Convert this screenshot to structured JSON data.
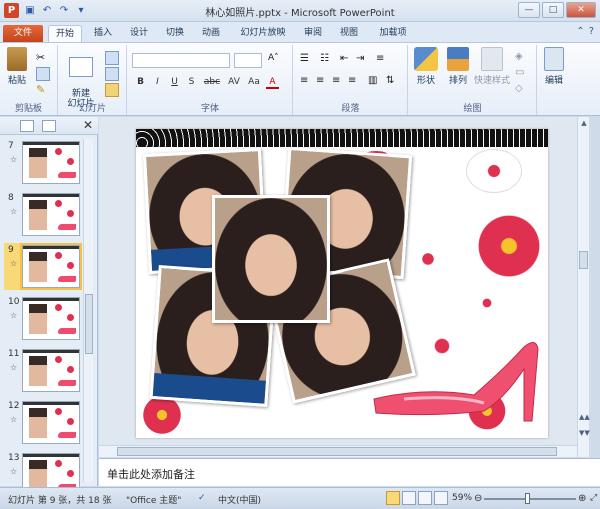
{
  "window": {
    "title": "林心如照片.pptx - Microsoft PowerPoint"
  },
  "qat": {
    "save_icon": "save-icon",
    "undo_icon": "undo-icon",
    "redo_icon": "redo-icon",
    "app_letter": "P"
  },
  "tabs": [
    {
      "label": "文件"
    },
    {
      "label": "开始"
    },
    {
      "label": "插入"
    },
    {
      "label": "设计"
    },
    {
      "label": "切换"
    },
    {
      "label": "动画"
    },
    {
      "label": "幻灯片放映"
    },
    {
      "label": "审阅"
    },
    {
      "label": "视图"
    },
    {
      "label": "加载项"
    }
  ],
  "ribbon": {
    "clipboard": {
      "paste_label": "粘贴",
      "group_label": "剪贴板"
    },
    "slides": {
      "new_slide_label": "新建\n幻灯片",
      "group_label": "幻灯片"
    },
    "font": {
      "group_label": "字体",
      "format_buttons": [
        "B",
        "I",
        "U",
        "S",
        "abc",
        "AV",
        "Aa",
        "A"
      ]
    },
    "paragraph": {
      "group_label": "段落"
    },
    "drawing": {
      "shape_label": "形状",
      "arrange_label": "排列",
      "quick_styles_label": "快速样式",
      "group_label": "绘图"
    },
    "editing": {
      "label": "编辑"
    }
  },
  "slides_pane": {
    "slides": [
      {
        "num": "7"
      },
      {
        "num": "8"
      },
      {
        "num": "9",
        "selected": true
      },
      {
        "num": "10"
      },
      {
        "num": "11"
      },
      {
        "num": "12"
      },
      {
        "num": "13"
      }
    ],
    "star": "☆"
  },
  "notes": {
    "placeholder": "单击此处添加备注"
  },
  "status": {
    "slide_info": "幻灯片 第 9 张，共 18 张",
    "theme": "\"Office 主题\"",
    "language": "中文(中国)",
    "zoom": "59%"
  }
}
